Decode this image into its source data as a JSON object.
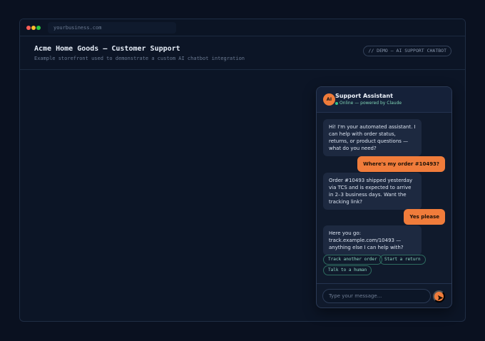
{
  "browser": {
    "url": "yourbusiness.com",
    "dot_colors": [
      "#ff5f57",
      "#febc2e",
      "#28c840"
    ]
  },
  "site": {
    "title": "Acme Home Goods — Customer Support",
    "subtitle": "Example storefront used to demonstrate a custom AI chatbot integration",
    "badge": "// DEMO — AI SUPPORT CHATBOT"
  },
  "chat": {
    "avatar_text": "AI",
    "title": "Support Assistant",
    "status": "Online — powered by Claude",
    "messages": [
      {
        "from": "bot",
        "text": "Hi! I'm your automated assistant. I can help with order status, returns, or product questions — what do you need?"
      },
      {
        "from": "user",
        "text": "Where's my order #10493?"
      },
      {
        "from": "bot",
        "text": "Order #10493 shipped yesterday via TCS and is expected to arrive in 2–3 business days. Want the tracking link?"
      },
      {
        "from": "user",
        "text": "Yes please"
      },
      {
        "from": "bot",
        "text": "Here you go: track.example.com/10493 — anything else I can help with?"
      }
    ],
    "quick_replies": [
      "Track another order",
      "Start a return",
      "Talk to a human"
    ],
    "input_placeholder": "Type your message...",
    "send_icon": "send-arrow-icon",
    "accent_color": "#f07c3b",
    "online_color": "#31c48d"
  }
}
